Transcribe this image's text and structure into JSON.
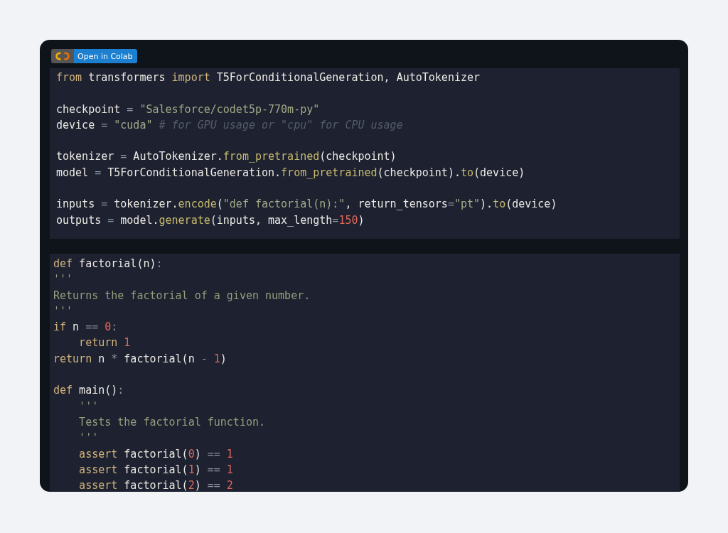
{
  "badge": {
    "label": "Open in Colab"
  },
  "code_blocks": [
    {
      "lines": [
        {
          "kind": "code",
          "tokens": [
            {
              "kind": "keyword",
              "text": "from"
            },
            {
              "kind": "name",
              "text": " transformers "
            },
            {
              "kind": "keyword",
              "text": "import"
            },
            {
              "kind": "name",
              "text": " T5ForConditionalGeneration, AutoTokenizer"
            }
          ]
        },
        {
          "kind": "blank"
        },
        {
          "kind": "code",
          "tokens": [
            {
              "kind": "name",
              "text": "checkpoint "
            },
            {
              "kind": "operator",
              "text": "="
            },
            {
              "kind": "string",
              "text": " \"Salesforce/codet5p-770m-py\""
            }
          ]
        },
        {
          "kind": "code",
          "tokens": [
            {
              "kind": "name",
              "text": "device "
            },
            {
              "kind": "operator",
              "text": "="
            },
            {
              "kind": "string",
              "text": " \"cuda\""
            },
            {
              "kind": "comment",
              "text": " # for GPU usage or \"cpu\" for CPU usage"
            }
          ]
        },
        {
          "kind": "blank"
        },
        {
          "kind": "code",
          "tokens": [
            {
              "kind": "name",
              "text": "tokenizer "
            },
            {
              "kind": "operator",
              "text": "="
            },
            {
              "kind": "name",
              "text": " AutoTokenizer."
            },
            {
              "kind": "function",
              "text": "from_pretrained"
            },
            {
              "kind": "name",
              "text": "(checkpoint)"
            }
          ]
        },
        {
          "kind": "code",
          "tokens": [
            {
              "kind": "name",
              "text": "model "
            },
            {
              "kind": "operator",
              "text": "="
            },
            {
              "kind": "name",
              "text": " T5ForConditionalGeneration."
            },
            {
              "kind": "function",
              "text": "from_pretrained"
            },
            {
              "kind": "name",
              "text": "(checkpoint)."
            },
            {
              "kind": "function",
              "text": "to"
            },
            {
              "kind": "name",
              "text": "(device)"
            }
          ]
        },
        {
          "kind": "blank"
        },
        {
          "kind": "code",
          "tokens": [
            {
              "kind": "name",
              "text": "inputs "
            },
            {
              "kind": "operator",
              "text": "="
            },
            {
              "kind": "name",
              "text": " tokenizer."
            },
            {
              "kind": "function",
              "text": "encode"
            },
            {
              "kind": "name",
              "text": "("
            },
            {
              "kind": "string",
              "text": "\"def factorial(n):\""
            },
            {
              "kind": "name",
              "text": ", return_tensors"
            },
            {
              "kind": "operator",
              "text": "="
            },
            {
              "kind": "string",
              "text": "\"pt\""
            },
            {
              "kind": "name",
              "text": ")."
            },
            {
              "kind": "function",
              "text": "to"
            },
            {
              "kind": "name",
              "text": "(device)"
            }
          ]
        },
        {
          "kind": "code",
          "tokens": [
            {
              "kind": "name",
              "text": "outputs "
            },
            {
              "kind": "operator",
              "text": "="
            },
            {
              "kind": "name",
              "text": " model."
            },
            {
              "kind": "function",
              "text": "generate"
            },
            {
              "kind": "name",
              "text": "(inputs, max_length"
            },
            {
              "kind": "operator",
              "text": "="
            },
            {
              "kind": "number",
              "text": "150"
            },
            {
              "kind": "name",
              "text": ")"
            }
          ]
        }
      ]
    },
    {
      "lines": [
        {
          "kind": "code",
          "tokens": [
            {
              "kind": "keyword",
              "text": "def"
            },
            {
              "kind": "name",
              "text": " factorial(n)"
            },
            {
              "kind": "operator",
              "text": ":"
            }
          ]
        },
        {
          "kind": "code",
          "tokens": [
            {
              "kind": "docstring",
              "text": "'''"
            }
          ]
        },
        {
          "kind": "code",
          "tokens": [
            {
              "kind": "docstring",
              "text": "Returns the factorial of a given number."
            }
          ]
        },
        {
          "kind": "code",
          "tokens": [
            {
              "kind": "docstring",
              "text": "'''"
            }
          ]
        },
        {
          "kind": "code",
          "tokens": [
            {
              "kind": "keyword",
              "text": "if"
            },
            {
              "kind": "name",
              "text": " n "
            },
            {
              "kind": "operator",
              "text": "=="
            },
            {
              "kind": "number",
              "text": " 0"
            },
            {
              "kind": "operator",
              "text": ":"
            }
          ]
        },
        {
          "kind": "code",
          "tokens": [
            {
              "kind": "keyword",
              "text": "    return"
            },
            {
              "kind": "number",
              "text": " 1"
            }
          ]
        },
        {
          "kind": "code",
          "tokens": [
            {
              "kind": "keyword",
              "text": "return"
            },
            {
              "kind": "name",
              "text": " n "
            },
            {
              "kind": "operator",
              "text": "*"
            },
            {
              "kind": "name",
              "text": " factorial(n "
            },
            {
              "kind": "operator",
              "text": "-"
            },
            {
              "kind": "number",
              "text": " 1"
            },
            {
              "kind": "name",
              "text": ")"
            }
          ]
        },
        {
          "kind": "blank"
        },
        {
          "kind": "code",
          "tokens": [
            {
              "kind": "keyword",
              "text": "def"
            },
            {
              "kind": "name",
              "text": " main()"
            },
            {
              "kind": "operator",
              "text": ":"
            }
          ]
        },
        {
          "kind": "code",
          "tokens": [
            {
              "kind": "docstring",
              "text": "    '''"
            }
          ]
        },
        {
          "kind": "code",
          "tokens": [
            {
              "kind": "docstring",
              "text": "    Tests the factorial function."
            }
          ]
        },
        {
          "kind": "code",
          "tokens": [
            {
              "kind": "docstring",
              "text": "    '''"
            }
          ]
        },
        {
          "kind": "code",
          "tokens": [
            {
              "kind": "keyword",
              "text": "    assert"
            },
            {
              "kind": "name",
              "text": " factorial("
            },
            {
              "kind": "number",
              "text": "0"
            },
            {
              "kind": "name",
              "text": ") "
            },
            {
              "kind": "operator",
              "text": "=="
            },
            {
              "kind": "number",
              "text": " 1"
            }
          ]
        },
        {
          "kind": "code",
          "tokens": [
            {
              "kind": "keyword",
              "text": "    assert"
            },
            {
              "kind": "name",
              "text": " factorial("
            },
            {
              "kind": "number",
              "text": "1"
            },
            {
              "kind": "name",
              "text": ") "
            },
            {
              "kind": "operator",
              "text": "=="
            },
            {
              "kind": "number",
              "text": " 1"
            }
          ]
        },
        {
          "kind": "code",
          "tokens": [
            {
              "kind": "keyword",
              "text": "    assert"
            },
            {
              "kind": "name",
              "text": " factorial("
            },
            {
              "kind": "number",
              "text": "2"
            },
            {
              "kind": "name",
              "text": ") "
            },
            {
              "kind": "operator",
              "text": "=="
            },
            {
              "kind": "number",
              "text": " 2"
            }
          ]
        }
      ]
    }
  ]
}
